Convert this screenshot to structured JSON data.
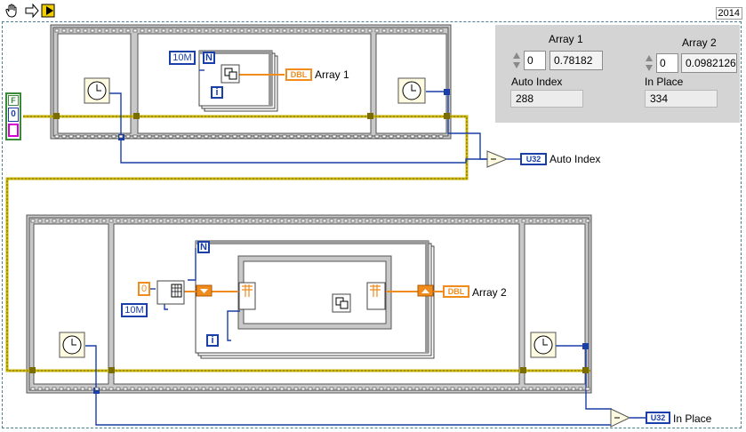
{
  "version": "2014",
  "toolbar": {
    "tools": [
      "hand-tool",
      "arrow-tool",
      "run-tool"
    ]
  },
  "panel": {
    "array1": {
      "label": "Array 1",
      "index": "0",
      "value": "0.78182"
    },
    "array2": {
      "label": "Array 2",
      "index": "0",
      "value": "0.0982126"
    },
    "auto_index": {
      "label": "Auto Index",
      "value": "288"
    },
    "in_place": {
      "label": "In Place",
      "value": "334"
    }
  },
  "diagram": {
    "constants": {
      "false_const": "F",
      "zero_const": "0",
      "n_top": "10M",
      "n_bottom": "10M",
      "init_value": "0"
    },
    "loop_count_label": "N",
    "loop_index_label": "i",
    "dbl_tag": "DBL",
    "u32_tag": "U32",
    "outputs": {
      "array1": "Array 1",
      "array2": "Array 2",
      "auto_index": "Auto Index",
      "in_place": "In Place"
    }
  },
  "colors": {
    "wire_blue": "#1b3fa8",
    "wire_orange": "#f08c1e",
    "wire_error": "#d6c200",
    "frame_fill": "#d6d6d6",
    "panel_bg": "#d4d4d4"
  }
}
